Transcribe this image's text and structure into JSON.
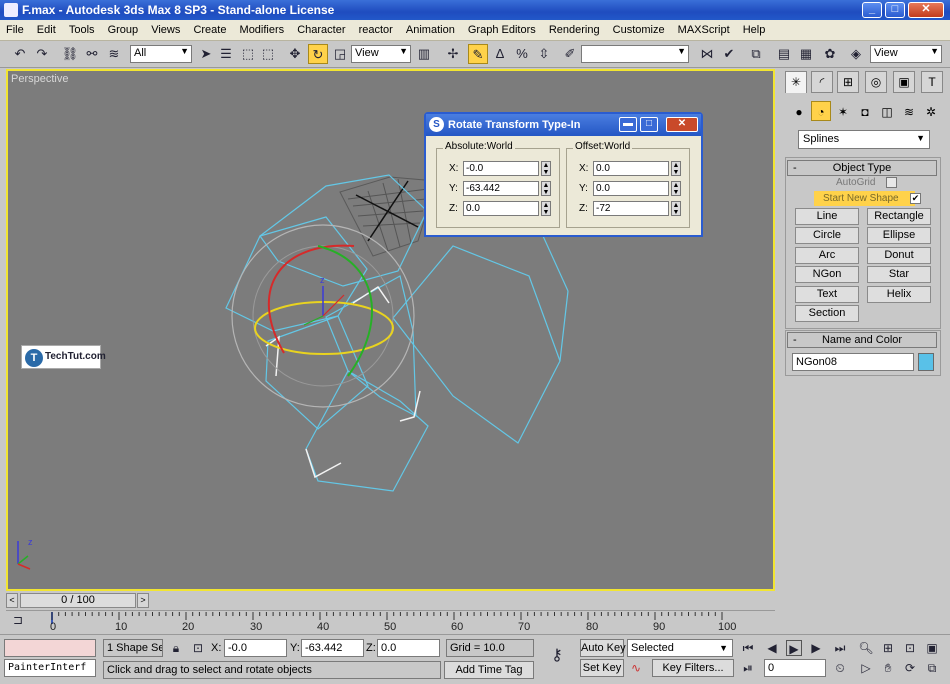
{
  "window": {
    "title": "F.max - Autodesk 3ds Max 8 SP3  - Stand-alone License",
    "min_label": "_",
    "max_label": "□",
    "close_label": "✕"
  },
  "menu": [
    "File",
    "Edit",
    "Tools",
    "Group",
    "Views",
    "Create",
    "Modifiers",
    "Character",
    "reactor",
    "Animation",
    "Graph Editors",
    "Rendering",
    "Customize",
    "MAXScript",
    "Help"
  ],
  "toolbar": {
    "selection_filter": "All",
    "ref_coord": "View",
    "named_selection": "",
    "right_view": "View"
  },
  "viewport": {
    "label": "Perspective"
  },
  "watermark": {
    "logo_letter": "T",
    "text": "TechTut.com"
  },
  "dialog": {
    "title": "Rotate Transform Type-In",
    "absolute": {
      "legend": "Absolute:World",
      "x": "-0.0",
      "y": "-63.442",
      "z": "0.0"
    },
    "offset": {
      "legend": "Offset:World",
      "x": "0.0",
      "y": "0.0",
      "z": "-72"
    },
    "labels": {
      "x": "X:",
      "y": "Y:",
      "z": "Z:"
    }
  },
  "command_panel": {
    "category": "Splines",
    "object_type": {
      "title": "Object Type",
      "autogrid": "AutoGrid",
      "start_new_shape": "Start New Shape",
      "buttons": [
        "Line",
        "Rectangle",
        "Circle",
        "Ellipse",
        "Arc",
        "Donut",
        "NGon",
        "Star",
        "Text",
        "Helix",
        "Section"
      ]
    },
    "name_color": {
      "title": "Name and Color",
      "name": "NGon08",
      "color": "#59c1e8"
    },
    "collapse": "-"
  },
  "timeslider": {
    "position": "0 / 100",
    "prev": "<",
    "next": ">"
  },
  "track": {
    "ticks": [
      "0",
      "10",
      "20",
      "30",
      "40",
      "50",
      "60",
      "70",
      "80",
      "90",
      "100"
    ]
  },
  "status": {
    "selection": "1 Shape Se",
    "x_label": "X:",
    "x_value": "-0.0",
    "y_label": "Y:",
    "y_value": "-63.442",
    "z_label": "Z:",
    "z_value": "0.0",
    "grid": "Grid = 10.0",
    "auto_key": "Auto Key",
    "set_key": "Set Key",
    "selected": "Selected",
    "key_filters": "Key Filters...",
    "add_time_tag": "Add Time Tag",
    "prompt": "Click and drag to select and rotate objects",
    "maxscript": "PainterInterf",
    "frame": "0"
  }
}
